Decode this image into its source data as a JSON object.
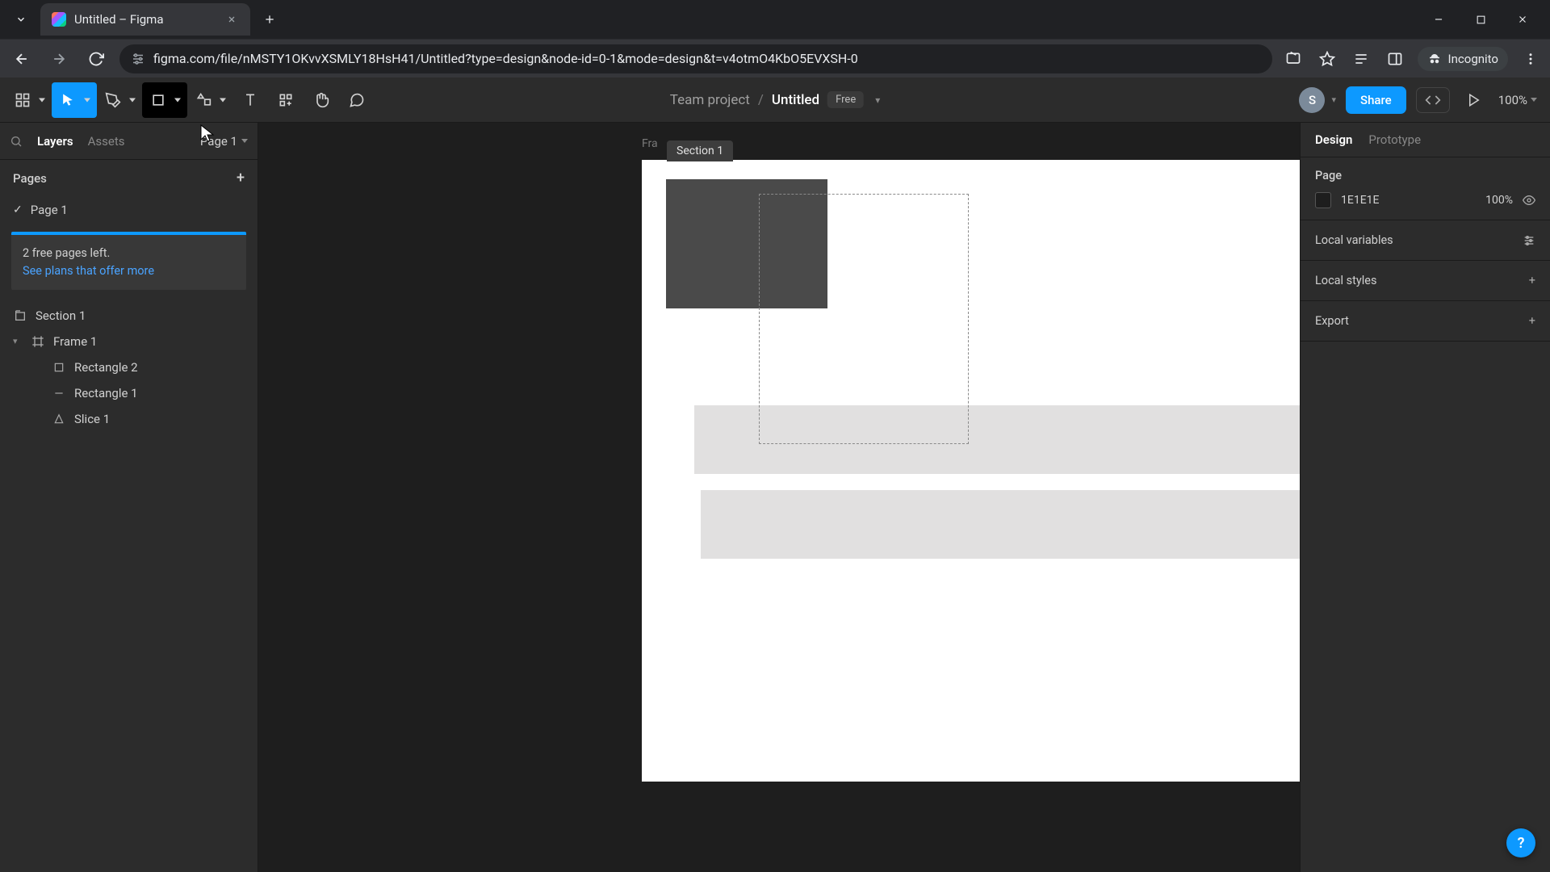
{
  "browser": {
    "tab_title": "Untitled – Figma",
    "url": "figma.com/file/nMSTY1OKvvXSMLY18HsH41/Untitled?type=design&node-id=0-1&mode=design&t=v4otmO4KbO5EVXSH-0",
    "incognito_label": "Incognito"
  },
  "toolbar": {
    "team": "Team project",
    "file": "Untitled",
    "plan_badge": "Free",
    "avatar_initial": "S",
    "share_label": "Share",
    "zoom": "100%"
  },
  "left_panel": {
    "tab_layers": "Layers",
    "tab_assets": "Assets",
    "page_selector": "Page 1",
    "pages_header": "Pages",
    "pages": [
      {
        "name": "Page 1",
        "checked": true
      }
    ],
    "promo_line1": "2 free pages left.",
    "promo_link": "See plans that offer more",
    "layers": [
      {
        "kind": "section",
        "name": "Section 1"
      },
      {
        "kind": "frame",
        "name": "Frame 1",
        "expanded": true
      },
      {
        "kind": "rect",
        "name": "Rectangle 2",
        "depth": 2
      },
      {
        "kind": "line",
        "name": "Rectangle 1",
        "depth": 2
      },
      {
        "kind": "slice",
        "name": "Slice 1",
        "depth": 2
      }
    ]
  },
  "canvas": {
    "frame_label": "Fra",
    "section_label": "Section 1"
  },
  "right_panel": {
    "tab_design": "Design",
    "tab_prototype": "Prototype",
    "page_section": "Page",
    "bg_hex": "1E1E1E",
    "bg_opacity": "100%",
    "local_variables": "Local variables",
    "local_styles": "Local styles",
    "export": "Export"
  },
  "help": "?"
}
